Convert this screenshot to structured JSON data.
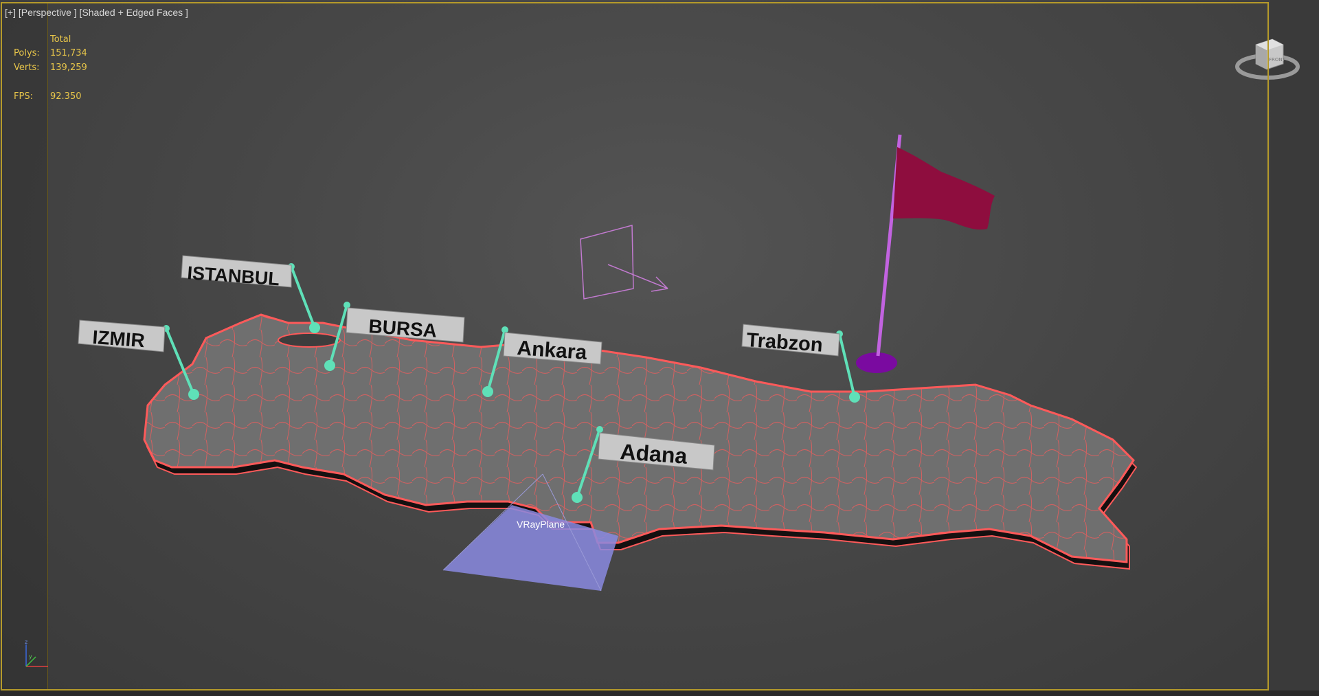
{
  "viewport": {
    "label": "[+] [Perspective ] [Shaded + Edged Faces ]"
  },
  "stats": {
    "header": "Total",
    "polys_label": "Polys:",
    "polys_value": "151,734",
    "verts_label": "Verts:",
    "verts_value": "139,259",
    "fps_label": "FPS:",
    "fps_value": "92.350"
  },
  "cities": [
    {
      "name": "IZMIR"
    },
    {
      "name": "ISTANBUL"
    },
    {
      "name": "BURSA"
    },
    {
      "name": "Ankara"
    },
    {
      "name": "Trabzon"
    },
    {
      "name": "Adana"
    }
  ],
  "objects": {
    "plane_label": "VRayPlane",
    "viewcube_face": "FRONT"
  },
  "colors": {
    "border": "#b59a2a",
    "stats": "#e8c64a",
    "map_fill": "#6f6f6f",
    "map_edge": "#ff5a5a",
    "pin": "#5fe0b8",
    "flag": "#8e0d3e",
    "pole": "#c263e0",
    "plane": "#8a8ae0"
  },
  "icons": {
    "viewcube": "viewcube-icon",
    "axis": "axis-tripod-icon",
    "camera": "camera-icon"
  }
}
